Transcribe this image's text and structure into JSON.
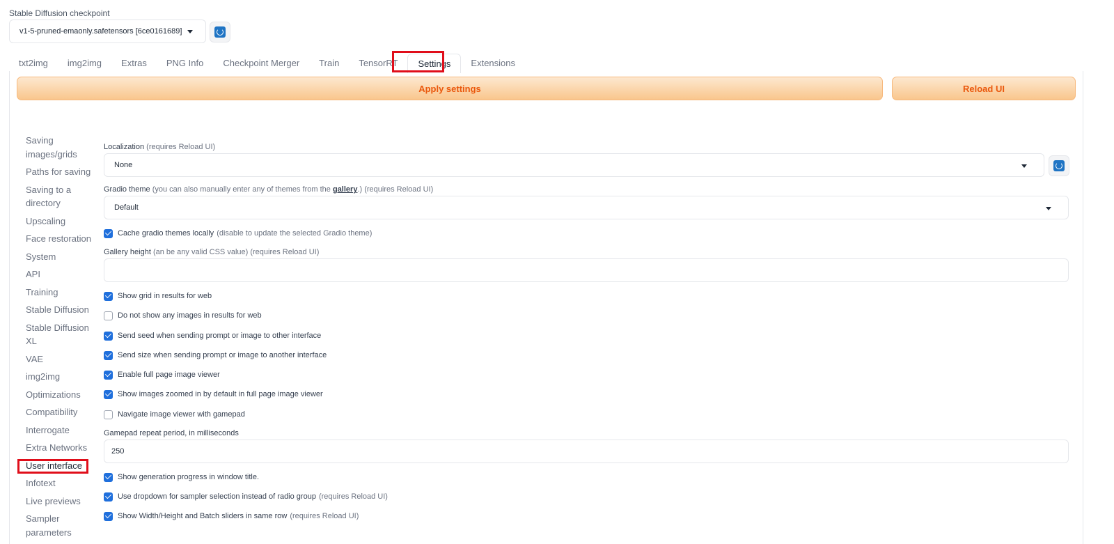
{
  "checkpoint": {
    "label": "Stable Diffusion checkpoint",
    "value": "v1-5-pruned-emaonly.safetensors [6ce0161689]"
  },
  "tabs": [
    {
      "label": "txt2img"
    },
    {
      "label": "img2img"
    },
    {
      "label": "Extras"
    },
    {
      "label": "PNG Info"
    },
    {
      "label": "Checkpoint Merger"
    },
    {
      "label": "Train"
    },
    {
      "label": "TensorRT"
    },
    {
      "label": "Settings",
      "active": true
    },
    {
      "label": "Extensions"
    }
  ],
  "actions": {
    "apply_label": "Apply settings",
    "reload_label": "Reload UI"
  },
  "sidebar": {
    "items": [
      {
        "label": "Saving images/grids"
      },
      {
        "label": "Paths for saving"
      },
      {
        "label": "Saving to a directory"
      },
      {
        "label": "Upscaling"
      },
      {
        "label": "Face restoration"
      },
      {
        "label": "System"
      },
      {
        "label": "API"
      },
      {
        "label": "Training"
      },
      {
        "label": "Stable Diffusion"
      },
      {
        "label": "Stable Diffusion XL"
      },
      {
        "label": "VAE"
      },
      {
        "label": "img2img"
      },
      {
        "label": "Optimizations"
      },
      {
        "label": "Compatibility"
      },
      {
        "label": "Interrogate"
      },
      {
        "label": "Extra Networks"
      },
      {
        "label": "User interface",
        "highlighted": true
      },
      {
        "label": "Infotext"
      },
      {
        "label": "Live previews"
      },
      {
        "label": "Sampler parameters"
      }
    ]
  },
  "settings": {
    "localization": {
      "label": "Localization",
      "note": "(requires Reload UI)",
      "value": "None"
    },
    "gradio_theme": {
      "label": "Gradio theme",
      "note_pre": "(you can also manually enter any of themes from the",
      "link": "gallery",
      "note_post": ".) (requires Reload UI)",
      "value": "Default"
    },
    "cache_themes": {
      "label": "Cache gradio themes locally",
      "note": "(disable to update the selected Gradio theme)",
      "checked": true
    },
    "gallery_height": {
      "label": "Gallery height",
      "note": "(an be any valid CSS value) (requires Reload UI)",
      "value": ""
    },
    "show_grid": {
      "label": "Show grid in results for web",
      "checked": true
    },
    "no_images": {
      "label": "Do not show any images in results for web",
      "checked": false
    },
    "send_seed": {
      "label": "Send seed when sending prompt or image to other interface",
      "checked": true
    },
    "send_size": {
      "label": "Send size when sending prompt or image to another interface",
      "checked": true
    },
    "full_viewer": {
      "label": "Enable full page image viewer",
      "checked": true
    },
    "zoomed": {
      "label": "Show images zoomed in by default in full page image viewer",
      "checked": true
    },
    "gamepad": {
      "label": "Navigate image viewer with gamepad",
      "checked": false
    },
    "gamepad_period": {
      "label": "Gamepad repeat period, in milliseconds",
      "value": "250"
    },
    "progress_title": {
      "label": "Show generation progress in window title.",
      "checked": true
    },
    "sampler_dropdown": {
      "label": "Use dropdown for sampler selection instead of radio group",
      "note": "(requires Reload UI)",
      "checked": true
    },
    "same_row": {
      "label": "Show Width/Height and Batch sliders in same row",
      "note": "(requires Reload UI)",
      "checked": true
    }
  },
  "colors": {
    "accent_orange": "#ea580c",
    "checkbox_blue": "#1f6fdc",
    "highlight_red": "#e00e1a"
  }
}
